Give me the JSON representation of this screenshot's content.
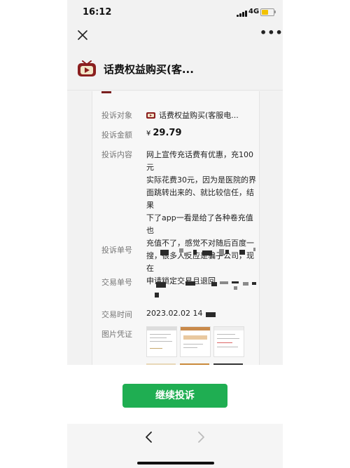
{
  "status": {
    "time": "16:12",
    "network": "4G"
  },
  "nav": {
    "close_icon": "close-icon",
    "more_icon": "more-icon",
    "more_label": "•••"
  },
  "header": {
    "app_title": "话费权益购买(客...",
    "logo_icon": "tv-logo-icon"
  },
  "complaint": {
    "target_label": "投诉对象",
    "target_value": "话费权益购买(客服电...",
    "amount_label": "投诉金额",
    "amount_currency": "¥",
    "amount_value": "29.79",
    "content_label": "投诉内容",
    "content_text": "网上宣传充话费有优惠，充100元\n实际花费30元，因为是医院的界\n面跳转出来的、就比较信任，结果\n下了app一看是给了各种卷充值也\n充值不了，感觉不对随后百度一\n搜，很多人反应是骗子公司，现在\n申请锁定交易且退回",
    "order_no_label": "投诉单号",
    "trade_no_label": "交易单号",
    "trade_time_label": "交易时间",
    "trade_time_value": "2023.02.02 14",
    "evidence_label": "图片凭证"
  },
  "actions": {
    "continue_label": "继续投诉"
  },
  "colors": {
    "accent_green": "#1fae52",
    "brand_red": "#8b1f1f"
  }
}
